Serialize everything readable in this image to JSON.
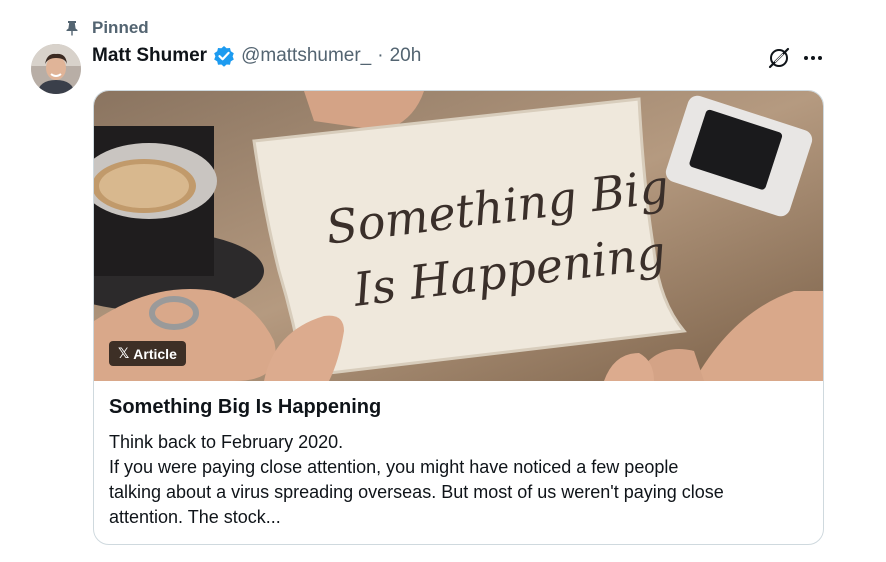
{
  "pinned": {
    "label": "Pinned",
    "icon": "pin-icon"
  },
  "author": {
    "name": "Matt Shumer",
    "handle": "@mattshumer_",
    "separator": "·",
    "time": "20h",
    "verified_color": "#1d9bf0"
  },
  "actions": {
    "grok_icon": "grok-icon",
    "more_icon": "more-icon"
  },
  "article": {
    "badge_logo": "𝕏",
    "badge_label": "Article",
    "image_text_line1": "Something Big",
    "image_text_line2": "Is Happening",
    "title": "Something Big Is Happening",
    "snippet_lines": [
      "Think back to February 2020.",
      "If you were paying close attention, you might have noticed a few people",
      "talking about a virus spreading overseas. But most of us weren't paying close",
      "attention. The stock..."
    ]
  },
  "colors": {
    "text": "#0f1419",
    "secondary": "#536471",
    "border": "#cfd9de"
  }
}
